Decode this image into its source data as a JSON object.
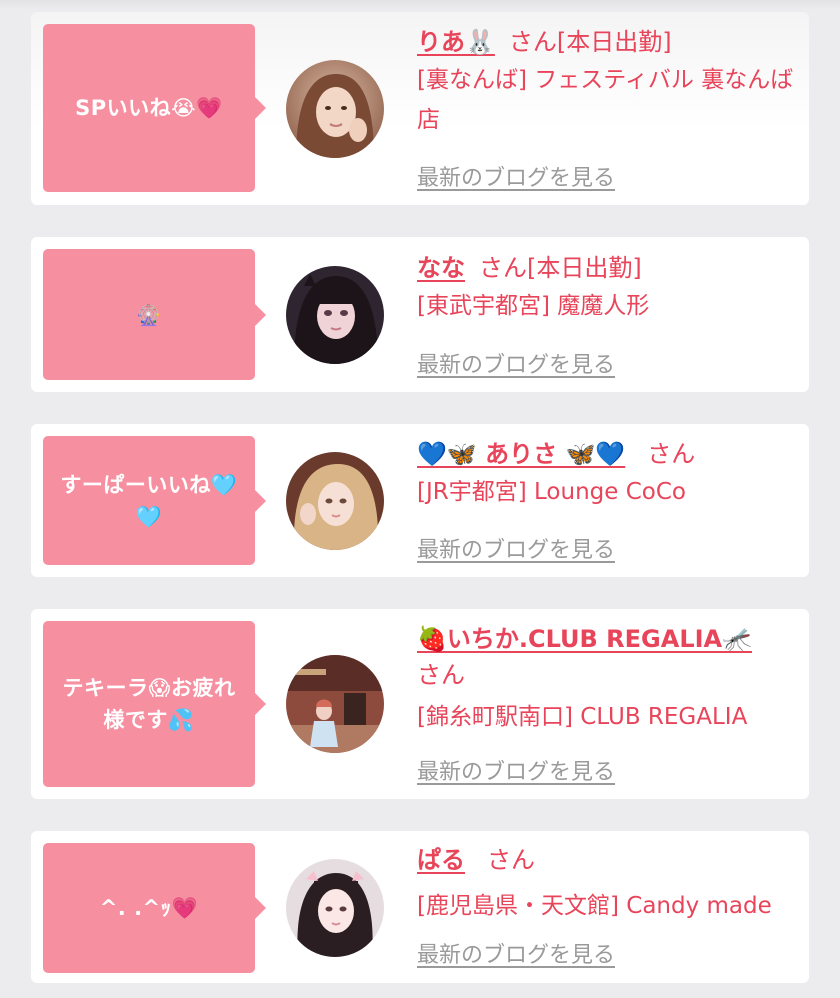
{
  "feed": {
    "items": [
      {
        "message": "SPいいね😭💗",
        "name": "りあ🐰",
        "honorific": "さん",
        "status": "[本日出勤]",
        "shop": "[裏なんば] フェスティバル 裏なんば店",
        "blog_link": "最新のブログを見る"
      },
      {
        "message": "🎡",
        "name": "なな",
        "honorific": "さん",
        "status": "[本日出勤]",
        "shop": "[東武宇都宮] 魔魔人形",
        "blog_link": "最新のブログを見る"
      },
      {
        "message": "すーぱーいいね🩵🩵",
        "name": "💙🦋 ありさ 🦋💙",
        "honorific": "さん",
        "status": "",
        "shop": "[JR宇都宮] Lounge CoCo",
        "blog_link": "最新のブログを見る"
      },
      {
        "message": "テキーラ😱お疲れ様です💦",
        "name": "🍓いちか.CLUB REGALIA🦟",
        "honorific": "さん",
        "status": "",
        "shop": "[錦糸町駅南口] CLUB REGALIA",
        "blog_link": "最新のブログを見る"
      },
      {
        "message": "^. .^ｯ💗",
        "name": "ぱる",
        "honorific": "さん",
        "status": "",
        "shop": "[鹿児島県・天文館] Candy made",
        "blog_link": "最新のブログを見る"
      }
    ]
  },
  "colors": {
    "accent_pink": "#e8445a",
    "bubble_pink": "#f68fa0",
    "blog_link_gray": "#9a9a9a",
    "background": "#ececee"
  }
}
